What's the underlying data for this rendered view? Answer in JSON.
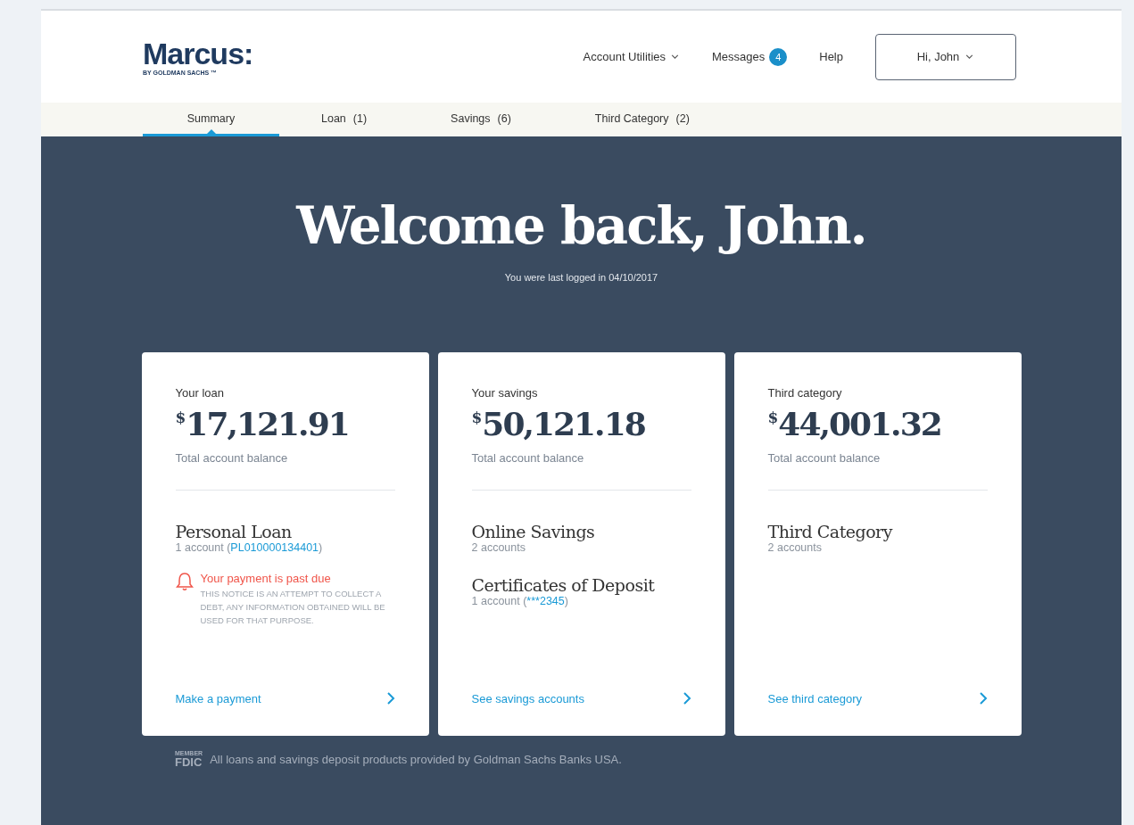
{
  "header": {
    "logo": {
      "name": "Marcus:",
      "tagline": "BY GOLDMAN SACHS ™"
    },
    "nav": [
      {
        "label": "Account Utilities",
        "kind": "dropdown"
      },
      {
        "label": "Messages",
        "kind": "badge",
        "badge": "4"
      },
      {
        "label": "Help",
        "kind": "link"
      }
    ],
    "user_menu": "Hi, John"
  },
  "tabs": [
    {
      "label": "Summary",
      "selected": true
    },
    {
      "label": "Loan",
      "count": "(1)",
      "selected": false
    },
    {
      "label": "Savings",
      "count": "(6)",
      "selected": false
    },
    {
      "label": "Third Category",
      "count": "(2)",
      "selected": false
    }
  ],
  "hero": {
    "title": "Welcome back, John.",
    "subtitle": "You were last logged in 04/10/2017"
  },
  "cards": [
    {
      "label": "Your loan",
      "currency": "$",
      "amount": "17,121.91",
      "caption": "Total account balance",
      "accounts": [
        {
          "name": "Personal Loan",
          "count": "1 account (",
          "number": "PL010000134401",
          "close": ")"
        }
      ],
      "alert": {
        "title": "Your payment is past due",
        "notice": "THIS NOTICE IS AN ATTEMPT TO COLLECT A DEBT, ANY INFORMATION OBTAINED WILL BE USED FOR THAT PURPOSE."
      },
      "action": "Make a payment"
    },
    {
      "label": "Your savings",
      "currency": "$",
      "amount": "50,121.18",
      "caption": "Total account balance",
      "accounts": [
        {
          "name": "Online Savings",
          "count": "2 accounts"
        },
        {
          "name": "Certificates of Deposit",
          "count": "1 account (",
          "number": "***2345",
          "close": ")"
        }
      ],
      "action": "See savings accounts"
    },
    {
      "label": "Third category",
      "currency": "$",
      "amount": "44,001.32",
      "caption": "Total account balance",
      "accounts": [
        {
          "name": "Third Category",
          "count": "2 accounts"
        }
      ],
      "action": "See third category"
    }
  ],
  "footer": {
    "fdic_member": "MEMBER",
    "fdic": "FDIC",
    "text": "All loans and savings deposit products provided by Goldman Sachs Banks USA."
  }
}
